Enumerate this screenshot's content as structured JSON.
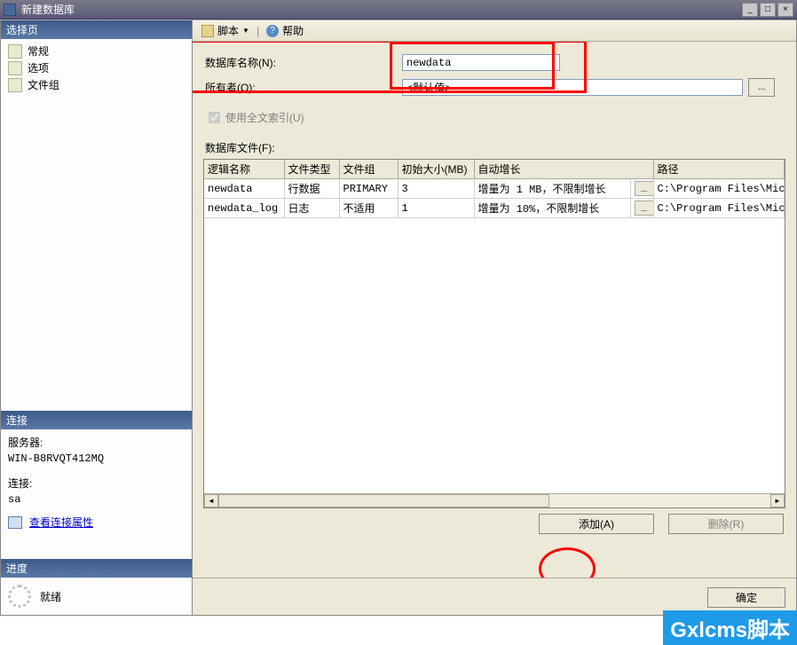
{
  "window": {
    "title": "新建数据库",
    "min": "_",
    "max": "□",
    "close": "×"
  },
  "toolbar": {
    "script": "脚本",
    "help": "帮助"
  },
  "sidebar": {
    "select_page_header": "选择页",
    "items": [
      "常规",
      "选项",
      "文件组"
    ],
    "connection_header": "连接",
    "server_label": "服务器:",
    "server_value": "WIN-B8RVQT412MQ",
    "conn_label": "连接:",
    "conn_value": "sa",
    "view_props": "查看连接属性",
    "progress_header": "进度",
    "ready": "就绪"
  },
  "form": {
    "db_name_label": "数据库名称(N):",
    "db_name_value": "newdata",
    "owner_label": "所有者(O):",
    "owner_value": "<默认值>",
    "fulltext_label": "使用全文索引(U)",
    "files_label": "数据库文件(F):"
  },
  "grid": {
    "headers": [
      "逻辑名称",
      "文件类型",
      "文件组",
      "初始大小(MB)",
      "自动增长",
      "路径"
    ],
    "rows": [
      {
        "name": "newdata",
        "type": "行数据",
        "group": "PRIMARY",
        "size": "3",
        "growth": "增量为 1 MB，不限制增长",
        "path": "C:\\Program Files\\Micr"
      },
      {
        "name": "newdata_log",
        "type": "日志",
        "group": "不适用",
        "size": "1",
        "growth": "增量为 10%，不限制增长",
        "path": "C:\\Program Files\\Micr"
      }
    ],
    "browse": "..."
  },
  "buttons": {
    "add": "添加(A)",
    "remove": "删除(R)",
    "ok": "确定",
    "browse": "..."
  },
  "watermark": "Gxlcms脚本"
}
